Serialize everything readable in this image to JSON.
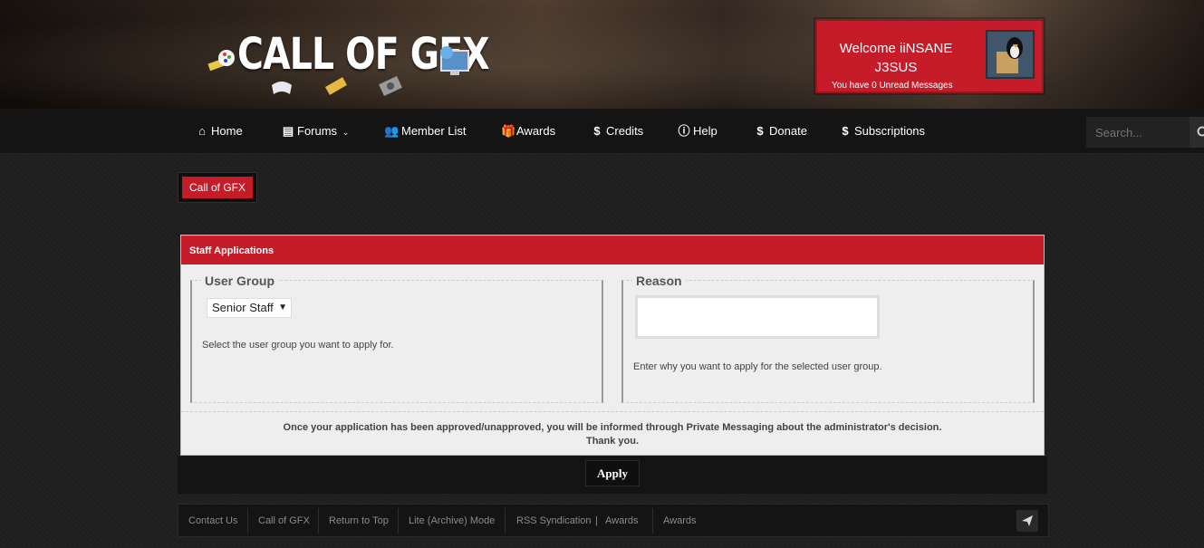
{
  "header": {
    "logo_text": "CALL OF GFX",
    "welcome_line": "Welcome iiNSANE J3SUS",
    "unread_line": "You have 0 Unread Messages"
  },
  "nav": {
    "items": [
      {
        "label": "Home",
        "icon": "home-icon"
      },
      {
        "label": "Forums",
        "icon": "document-icon",
        "has_dropdown": true
      },
      {
        "label": "Member List",
        "icon": "users-icon"
      },
      {
        "label": "Awards",
        "icon": "gift-icon"
      },
      {
        "label": "Credits",
        "icon": "dollar-icon"
      },
      {
        "label": "Help",
        "icon": "info-icon"
      },
      {
        "label": "Donate",
        "icon": "dollar-icon"
      },
      {
        "label": "Subscriptions",
        "icon": "dollar-icon"
      }
    ],
    "search_placeholder": "Search..."
  },
  "breadcrumb": {
    "label": "Call of GFX"
  },
  "panel": {
    "title": "Staff Applications",
    "user_group": {
      "legend": "User Group",
      "selected": "Senior Staff",
      "help": "Select the user group you want to apply for."
    },
    "reason": {
      "legend": "Reason",
      "value": "",
      "help": "Enter why you want to apply for the selected user group."
    },
    "notice_line1": "Once your application has been approved/unapproved, you will be informed through Private Messaging about the administrator's decision.",
    "notice_line2": "Thank you."
  },
  "apply_label": "Apply",
  "footer": {
    "links": [
      "Contact Us",
      "Call of GFX",
      "Return to Top",
      "Lite (Archive) Mode",
      "RSS Syndication",
      "|",
      "Awards",
      "Awards"
    ]
  },
  "colors": {
    "accent": "#c61c29",
    "nav_bg": "#141414",
    "panel_bg": "#eeeeee"
  }
}
